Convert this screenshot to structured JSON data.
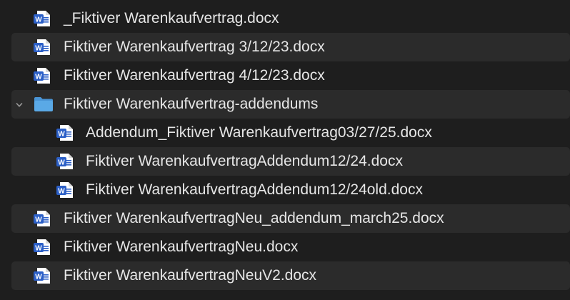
{
  "files": [
    {
      "name": "_Fiktiver Warenkaufvertrag.docx",
      "kind": "docx",
      "level": 0,
      "icon": "word-doc-icon"
    },
    {
      "name": "Fiktiver Warenkaufvertrag 3/12/23.docx",
      "kind": "docx",
      "level": 0,
      "icon": "word-doc-icon"
    },
    {
      "name": "Fiktiver Warenkaufvertrag 4/12/23.docx",
      "kind": "docx",
      "level": 0,
      "icon": "word-doc-icon"
    },
    {
      "name": "Fiktiver Warenkaufvertrag-addendums",
      "kind": "folder",
      "level": 0,
      "expanded": true,
      "icon": "folder-icon"
    },
    {
      "name": "Addendum_Fiktiver Warenkaufvertrag03/27/25.docx",
      "kind": "docx",
      "level": 1,
      "icon": "word-doc-icon"
    },
    {
      "name": "Fiktiver WarenkaufvertragAddendum12/24.docx",
      "kind": "docx",
      "level": 1,
      "icon": "word-doc-icon"
    },
    {
      "name": "Fiktiver WarenkaufvertragAddendum12/24old.docx",
      "kind": "docx",
      "level": 1,
      "icon": "word-doc-icon"
    },
    {
      "name": "Fiktiver WarenkaufvertragNeu_addendum_march25.docx",
      "kind": "docx",
      "level": 0,
      "icon": "word-doc-icon"
    },
    {
      "name": "Fiktiver WarenkaufvertragNeu.docx",
      "kind": "docx",
      "level": 0,
      "icon": "word-doc-icon"
    },
    {
      "name": "Fiktiver WarenkaufvertragNeuV2.docx",
      "kind": "docx",
      "level": 0,
      "icon": "word-doc-icon"
    }
  ],
  "colors": {
    "background": "#1e1e1e",
    "alternate_row": "#2b2b2b",
    "text": "#e6e6e6",
    "word_blue": "#2b5fc7",
    "folder_blue": "#5aa9e6"
  }
}
